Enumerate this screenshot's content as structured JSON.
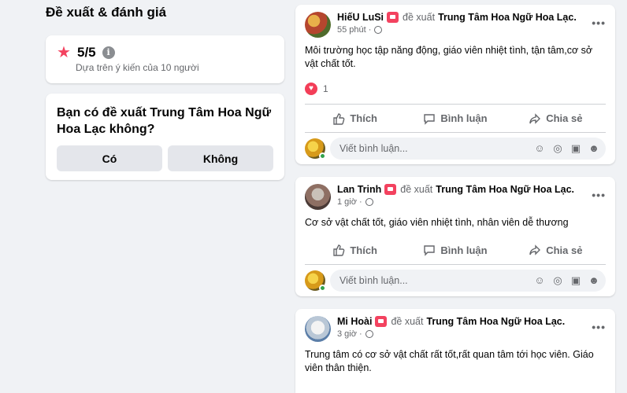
{
  "left": {
    "section_title": "Đề xuất & đánh giá",
    "rating": {
      "value": "5/5",
      "info_glyph": "i",
      "subtext": "Dựa trên ý kiến của 10 người"
    },
    "recommend": {
      "question": "Bạn có đề xuất Trung Tâm Hoa Ngữ Hoa Lạc không?",
      "yes_label": "Có",
      "no_label": "Không"
    }
  },
  "posts": [
    {
      "author": "HiếU LuSi",
      "recommends": "đề xuất",
      "page": "Trung Tâm Hoa Ngữ Hoa Lạc.",
      "time": "55 phút ·",
      "body": "Môi trường học tập năng động, giáo viên nhiệt tình, tận tâm,cơ sở vật chất tốt.",
      "reaction_count": "1"
    },
    {
      "author": "Lan Trinh",
      "recommends": "đề xuất",
      "page": "Trung Tâm Hoa Ngữ Hoa Lạc.",
      "time": "1 giờ ·",
      "body": "Cơ sở vật chất tốt, giáo viên nhiệt tình, nhân viên dễ thương"
    },
    {
      "author": "Mi Hoài",
      "recommends": "đề xuất",
      "page": "Trung Tâm Hoa Ngữ Hoa Lạc.",
      "time": "3 giờ ·",
      "body": "Trung tâm có cơ sở vật chất rất tốt,rất quan tâm tới học viên. Giáo viên thân thiện."
    }
  ],
  "actions": {
    "like": "Thích",
    "comment": "Bình luận",
    "share": "Chia sẻ"
  },
  "comment_placeholder": "Viết bình luận...",
  "more_glyph": "•••",
  "colors": {
    "page_bg": "#f0f2f5",
    "card_bg": "#ffffff",
    "accent_red": "#f3425f",
    "secondary_text": "#65676b",
    "button_gray": "#e4e6eb",
    "online_green": "#31a24c"
  }
}
